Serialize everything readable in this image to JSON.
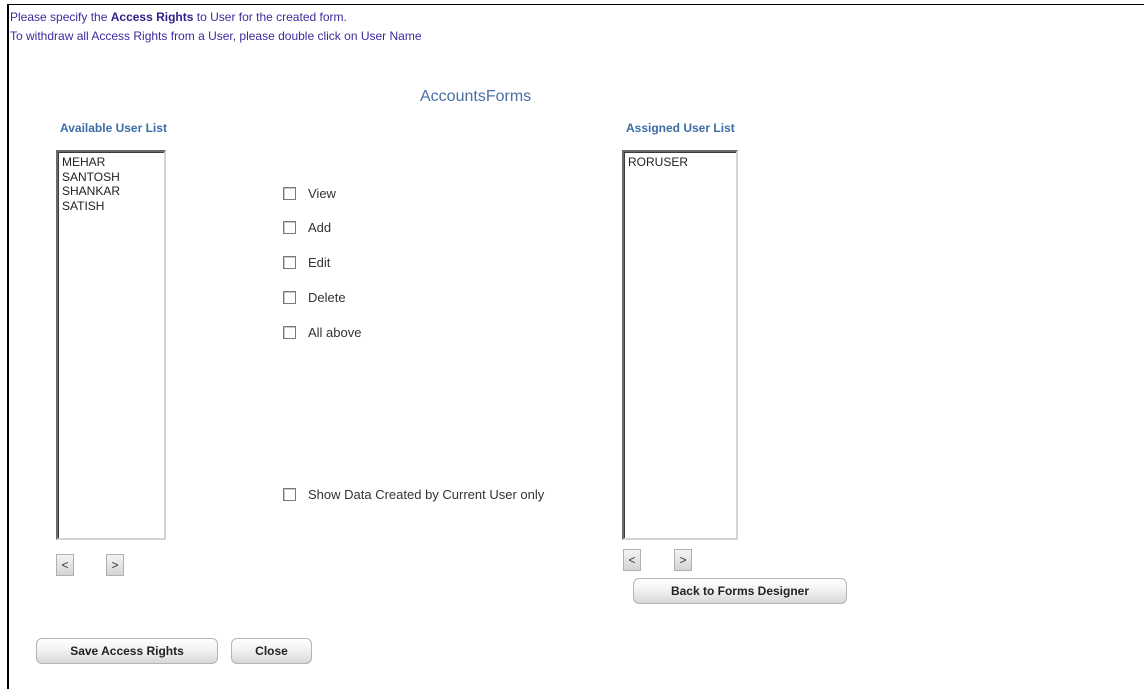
{
  "instructions": {
    "line1_pre": "Please specify the ",
    "line1_bold": "Access Rights",
    "line1_post": " to User for the created form.",
    "line2": "To withdraw all Access Rights from a User, please double click on User Name"
  },
  "form_title": "AccountsForms",
  "available": {
    "title": "Available User List",
    "items": [
      "MEHAR",
      "SANTOSH",
      "SHANKAR",
      "SATISH"
    ],
    "move_left": "<",
    "move_right": ">"
  },
  "assigned": {
    "title": "Assigned User List",
    "items": [
      "RORUSER"
    ],
    "move_left": "<",
    "move_right": ">"
  },
  "rights": {
    "view": "View",
    "add": "Add",
    "edit": "Edit",
    "delete": "Delete",
    "all": "All above",
    "current_user_only": "Show Data Created by Current User only"
  },
  "buttons": {
    "back": "Back to Forms Designer",
    "save": "Save Access Rights",
    "close": "Close"
  }
}
